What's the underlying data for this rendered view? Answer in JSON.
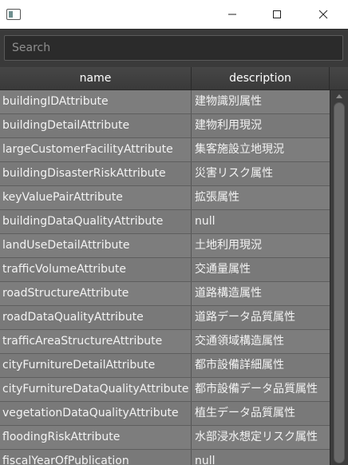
{
  "window": {
    "controls": {
      "minimize_icon": "minimize-icon",
      "maximize_icon": "maximize-icon",
      "close_icon": "close-icon"
    }
  },
  "search": {
    "placeholder": "Search",
    "value": ""
  },
  "table": {
    "columns": [
      "name",
      "description"
    ],
    "rows": [
      {
        "name": "buildingIDAttribute",
        "description": "建物識別属性"
      },
      {
        "name": "buildingDetailAttribute",
        "description": "建物利用現況"
      },
      {
        "name": "largeCustomerFacilityAttribute",
        "description": "集客施設立地現況"
      },
      {
        "name": "buildingDisasterRiskAttribute",
        "description": "災害リスク属性"
      },
      {
        "name": "keyValuePairAttribute",
        "description": "拡張属性"
      },
      {
        "name": "buildingDataQualityAttribute",
        "description": "null"
      },
      {
        "name": "landUseDetailAttribute",
        "description": "土地利用現況"
      },
      {
        "name": "trafficVolumeAttribute",
        "description": "交通量属性"
      },
      {
        "name": "roadStructureAttribute",
        "description": "道路構造属性"
      },
      {
        "name": "roadDataQualityAttribute",
        "description": "道路データ品質属性"
      },
      {
        "name": "trafficAreaStructureAttribute",
        "description": "交通領域構造属性"
      },
      {
        "name": "cityFurnitureDetailAttribute",
        "description": "都市設備詳細属性"
      },
      {
        "name": "cityFurnitureDataQualityAttribute",
        "description": "都市設備データ品質属性"
      },
      {
        "name": "vegetationDataQualityAttribute",
        "description": "植生データ品質属性"
      },
      {
        "name": "floodingRiskAttribute",
        "description": "水部浸水想定リスク属性"
      },
      {
        "name": "fiscalYearOfPublication",
        "description": "null"
      }
    ]
  },
  "colors": {
    "header_bg": "#3f3f3f",
    "row_bg": "#7d7d7d",
    "text": "#f3f3f3",
    "titlebar_bg": "#ffffff"
  }
}
